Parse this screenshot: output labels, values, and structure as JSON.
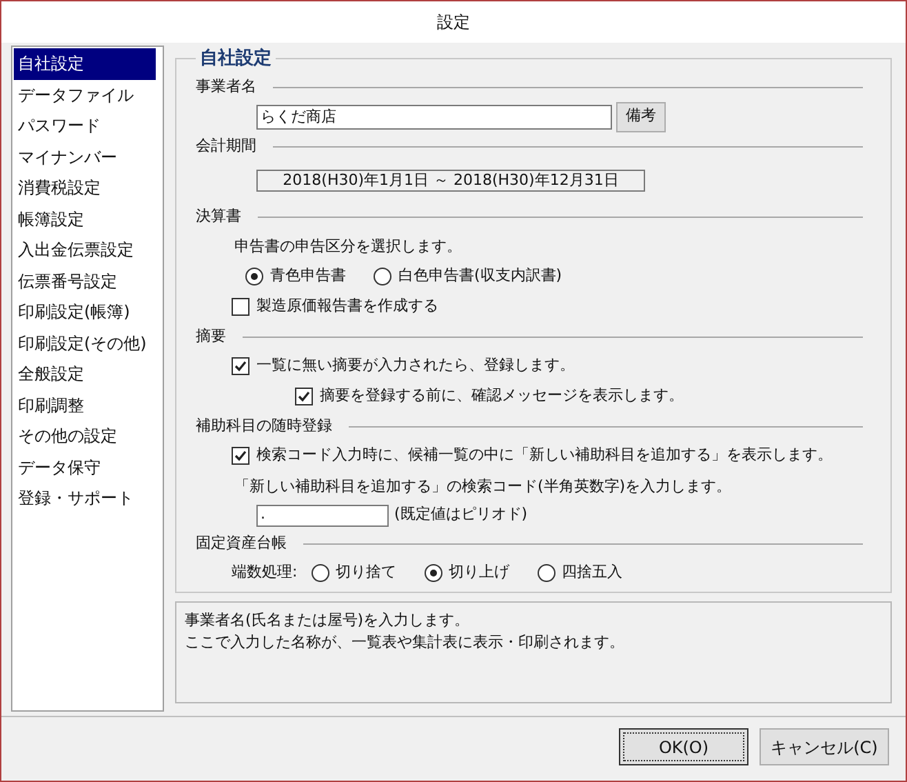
{
  "window": {
    "title": "設定"
  },
  "sidebar": {
    "items": [
      {
        "label": "自社設定",
        "selected": true
      },
      {
        "label": "データファイル",
        "selected": false
      },
      {
        "label": "パスワード",
        "selected": false
      },
      {
        "label": "マイナンバー",
        "selected": false
      },
      {
        "label": "消費税設定",
        "selected": false
      },
      {
        "label": "帳簿設定",
        "selected": false
      },
      {
        "label": "入出金伝票設定",
        "selected": false
      },
      {
        "label": "伝票番号設定",
        "selected": false
      },
      {
        "label": "印刷設定(帳簿)",
        "selected": false
      },
      {
        "label": "印刷設定(その他)",
        "selected": false
      },
      {
        "label": "全般設定",
        "selected": false
      },
      {
        "label": "印刷調整",
        "selected": false
      },
      {
        "label": "その他の設定",
        "selected": false
      },
      {
        "label": "データ保守",
        "selected": false
      },
      {
        "label": "登録・サポート",
        "selected": false
      }
    ]
  },
  "panel": {
    "title": "自社設定",
    "sections": [
      {
        "heading": "事業者名",
        "rows": [
          {
            "kind": "field",
            "value": "らくだ商店",
            "button": "備考"
          }
        ]
      },
      {
        "heading": "会計期間",
        "rows": [
          {
            "kind": "readonly",
            "value": "2018(H30)年1月1日 ～ 2018(H30)年12月31日"
          }
        ]
      },
      {
        "heading": "決算書",
        "rows": [
          {
            "kind": "text",
            "text": "申告書の申告区分を選択します。"
          },
          {
            "kind": "radios",
            "options": [
              {
                "label": "青色申告書",
                "selected": true
              },
              {
                "label": "白色申告書(収支内訳書)",
                "selected": false
              }
            ]
          },
          {
            "kind": "checkbox",
            "label": "製造原価報告書を作成する",
            "checked": false
          }
        ]
      },
      {
        "heading": "摘要",
        "rows": [
          {
            "kind": "checkbox",
            "label": "一覧に無い摘要が入力されたら、登録します。",
            "checked": true,
            "children": [
              {
                "kind": "checkbox",
                "label": "摘要を登録する前に、確認メッセージを表示します。",
                "checked": true
              }
            ]
          }
        ]
      },
      {
        "heading": "補助科目の随時登録",
        "rows": [
          {
            "kind": "checkbox",
            "label": "検索コード入力時に、候補一覧の中に「新しい補助科目を追加する」を表示します。",
            "checked": true
          },
          {
            "kind": "text",
            "text": "「新しい補助科目を追加する」の検索コード(半角英数字)を入力します。"
          },
          {
            "kind": "small-field",
            "value": ".",
            "note": "(既定値はピリオド)"
          }
        ]
      },
      {
        "heading": "固定資産台帳",
        "rows": [
          {
            "kind": "radios",
            "label": "端数処理:",
            "options": [
              {
                "label": "切り捨て",
                "selected": false
              },
              {
                "label": "切り上げ",
                "selected": true
              },
              {
                "label": "四捨五入",
                "selected": false
              }
            ]
          }
        ]
      }
    ]
  },
  "help": {
    "lines": [
      "事業者名(氏名または屋号)を入力します。",
      "ここで入力した名称が、一覧表や集計表に表示・印刷されます。"
    ]
  },
  "buttons": [
    {
      "label": "OK(O)",
      "default": true
    },
    {
      "label": "キャンセル(C)",
      "default": false
    }
  ]
}
